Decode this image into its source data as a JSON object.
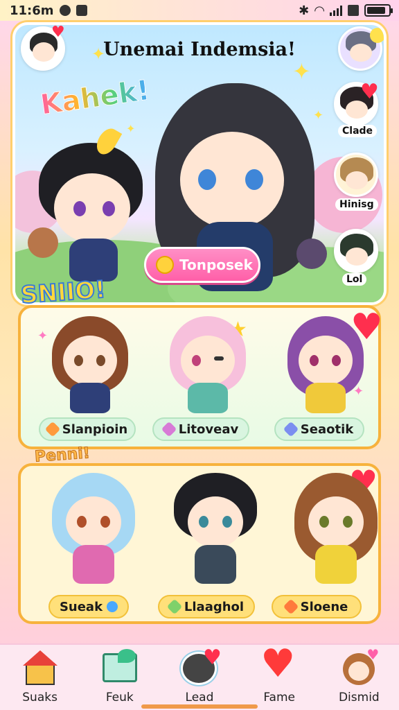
{
  "status_bar": {
    "time": "11:6m",
    "battery_level": 0.85
  },
  "hero": {
    "title": "Unemai Indemsia!",
    "exclaim": "Kahek!",
    "start_button": "Tonposek",
    "side_labels": [
      "Clade",
      "Hinisg",
      "Lol"
    ]
  },
  "panel_1": {
    "stamp": "SNIIO!",
    "cards": [
      {
        "label": "Slanpioin",
        "mark_color": "#ff9a3c"
      },
      {
        "label": "Litoveav",
        "mark_color": "#d77ad6"
      },
      {
        "label": "Seaotik",
        "mark_color": "#7b8ef0"
      }
    ]
  },
  "panel_2": {
    "stamp": "Penni!",
    "cards": [
      {
        "label": "Sueak",
        "mark_color": "#4aa8ff"
      },
      {
        "label": "Llaaghol",
        "mark_color": "#7fd16a"
      },
      {
        "label": "Sloene",
        "mark_color": "#ff7a3c"
      }
    ]
  },
  "bottom_nav": [
    {
      "label": "Suaks",
      "icon": "house-icon"
    },
    {
      "label": "Feuk",
      "icon": "photo-icon"
    },
    {
      "label": "Lead",
      "icon": "cat-icon"
    },
    {
      "label": "Fame",
      "icon": "heart-icon"
    },
    {
      "label": "Dismid",
      "icon": "bear-icon"
    }
  ],
  "colors": {
    "accent_pink": "#ff5fa8",
    "panel_border": "#f7b23c",
    "heart": "#ff2f4e"
  }
}
